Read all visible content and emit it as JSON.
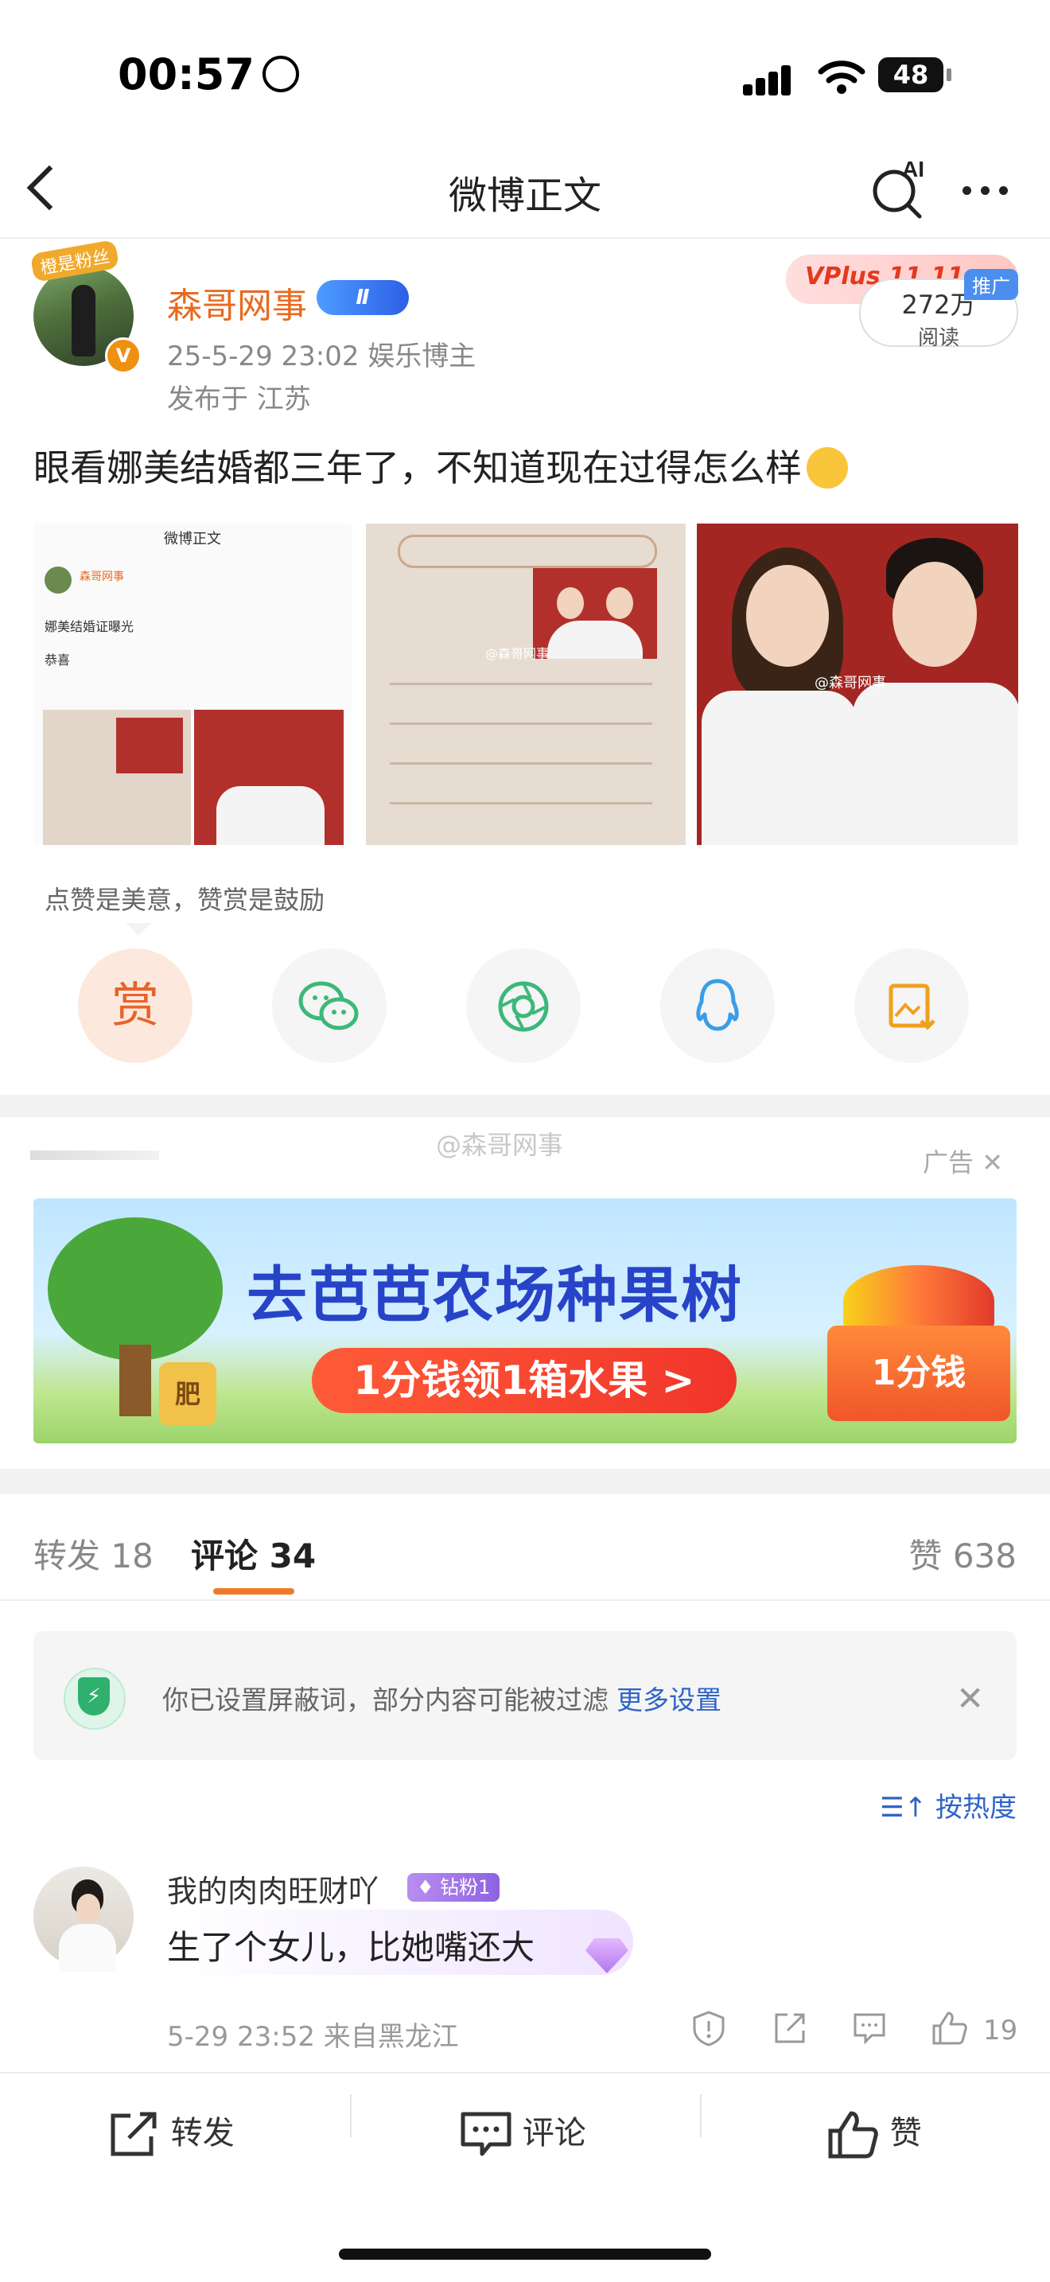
{
  "status": {
    "time": "00:57",
    "battery": "48"
  },
  "nav": {
    "title": "微博正文",
    "ai_label": "AI"
  },
  "post": {
    "author": "森哥网事",
    "avatar_badge": "橙是粉丝",
    "vip_level": "Ⅱ",
    "meta": "25-5-29 23:02  娱乐博主",
    "location": "发布于 江苏",
    "ad_tag": "VPlus 11.11",
    "promote_label": "推广",
    "read_count": "272万",
    "read_label": "阅读",
    "text": "眼看娜美结婚都三年了，不知道现在过得怎么样",
    "images": {
      "img1_title": "微博正文",
      "img1_author": "森哥网事",
      "img1_line": "娜美结婚证曝光",
      "img1_line2": "恭喜",
      "img2_watermark": "@森哥网事",
      "img3_watermark": "@森哥网事"
    },
    "reward_tip": "点赞是美意，赞赏是鼓励",
    "share": {
      "reward_label": "赏"
    }
  },
  "ad": {
    "label": "广告",
    "watermark": "@森哥网事",
    "headline": "去芭芭农场种果树",
    "cta": "1分钱领1箱水果 >",
    "box_text": "1分钱",
    "pot_text": "肥"
  },
  "tabs": {
    "repost": "转发 18",
    "comments": "评论 34",
    "likes": "赞 638"
  },
  "filter": {
    "text": "你已设置屏蔽词，部分内容可能被过滤",
    "link": "更多设置"
  },
  "sort_label": "按热度",
  "comment": {
    "user": "我的肉肉旺财吖",
    "fan_badge": "钻粉1",
    "text": "生了个女儿，比她嘴还大",
    "time": "5-29 23:52  来自黑龙江",
    "likes": "19"
  },
  "bottom": {
    "repost": "转发",
    "comment": "评论",
    "like": "赞"
  },
  "colors": {
    "accent": "#f07a2a",
    "link": "#2f64c8",
    "username": "#e86a20"
  }
}
